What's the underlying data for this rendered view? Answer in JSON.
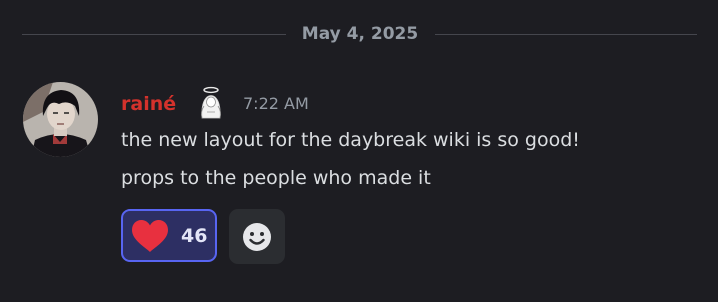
{
  "divider": {
    "date": "May 4, 2025"
  },
  "message": {
    "username": "rainé",
    "username_color": "#d4322c",
    "badge_icon": "angel-portrait-icon",
    "timestamp": "7:22 AM",
    "lines": [
      "the new layout for the daybreak wiki is so good!",
      "props to the people who made it"
    ],
    "reactions": [
      {
        "emoji": "red-heart",
        "count": "46",
        "selected": true
      }
    ],
    "add_reaction_icon": "smiley-add-reaction-icon"
  },
  "colors": {
    "background": "#1d1d22",
    "accent": "#5865f2",
    "text": "#dbdee1",
    "muted": "#949ba4",
    "heart": "#e8303f"
  }
}
